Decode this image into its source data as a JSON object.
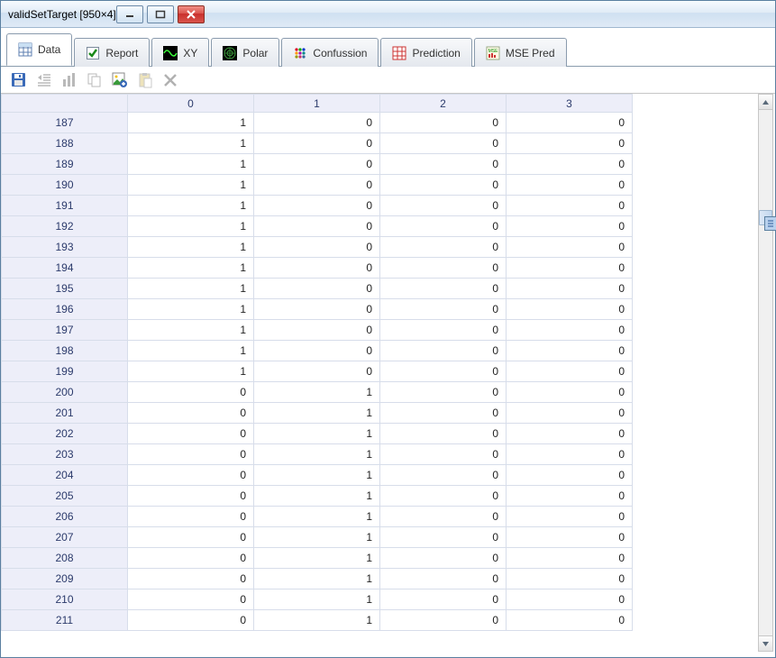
{
  "window": {
    "title": "validSetTarget [950×4]"
  },
  "tabs": [
    {
      "label": "Data",
      "icon": "grid"
    },
    {
      "label": "Report",
      "icon": "check"
    },
    {
      "label": "XY",
      "icon": "wave"
    },
    {
      "label": "Polar",
      "icon": "polar"
    },
    {
      "label": "Confussion",
      "icon": "dots"
    },
    {
      "label": "Prediction",
      "icon": "grid2"
    },
    {
      "label": "MSE Pred",
      "icon": "mse"
    }
  ],
  "active_tab": 0,
  "columns": [
    "0",
    "1",
    "2",
    "3"
  ],
  "rows": [
    {
      "idx": "187",
      "v": [
        "1",
        "0",
        "0",
        "0"
      ]
    },
    {
      "idx": "188",
      "v": [
        "1",
        "0",
        "0",
        "0"
      ]
    },
    {
      "idx": "189",
      "v": [
        "1",
        "0",
        "0",
        "0"
      ]
    },
    {
      "idx": "190",
      "v": [
        "1",
        "0",
        "0",
        "0"
      ]
    },
    {
      "idx": "191",
      "v": [
        "1",
        "0",
        "0",
        "0"
      ]
    },
    {
      "idx": "192",
      "v": [
        "1",
        "0",
        "0",
        "0"
      ]
    },
    {
      "idx": "193",
      "v": [
        "1",
        "0",
        "0",
        "0"
      ]
    },
    {
      "idx": "194",
      "v": [
        "1",
        "0",
        "0",
        "0"
      ]
    },
    {
      "idx": "195",
      "v": [
        "1",
        "0",
        "0",
        "0"
      ]
    },
    {
      "idx": "196",
      "v": [
        "1",
        "0",
        "0",
        "0"
      ]
    },
    {
      "idx": "197",
      "v": [
        "1",
        "0",
        "0",
        "0"
      ]
    },
    {
      "idx": "198",
      "v": [
        "1",
        "0",
        "0",
        "0"
      ]
    },
    {
      "idx": "199",
      "v": [
        "1",
        "0",
        "0",
        "0"
      ]
    },
    {
      "idx": "200",
      "v": [
        "0",
        "1",
        "0",
        "0"
      ]
    },
    {
      "idx": "201",
      "v": [
        "0",
        "1",
        "0",
        "0"
      ]
    },
    {
      "idx": "202",
      "v": [
        "0",
        "1",
        "0",
        "0"
      ]
    },
    {
      "idx": "203",
      "v": [
        "0",
        "1",
        "0",
        "0"
      ]
    },
    {
      "idx": "204",
      "v": [
        "0",
        "1",
        "0",
        "0"
      ]
    },
    {
      "idx": "205",
      "v": [
        "0",
        "1",
        "0",
        "0"
      ]
    },
    {
      "idx": "206",
      "v": [
        "0",
        "1",
        "0",
        "0"
      ]
    },
    {
      "idx": "207",
      "v": [
        "0",
        "1",
        "0",
        "0"
      ]
    },
    {
      "idx": "208",
      "v": [
        "0",
        "1",
        "0",
        "0"
      ]
    },
    {
      "idx": "209",
      "v": [
        "0",
        "1",
        "0",
        "0"
      ]
    },
    {
      "idx": "210",
      "v": [
        "0",
        "1",
        "0",
        "0"
      ]
    },
    {
      "idx": "211",
      "v": [
        "0",
        "1",
        "0",
        "0"
      ]
    }
  ],
  "scroll": {
    "thumb_top_pct": 19,
    "thumb_height_pct": 3
  }
}
